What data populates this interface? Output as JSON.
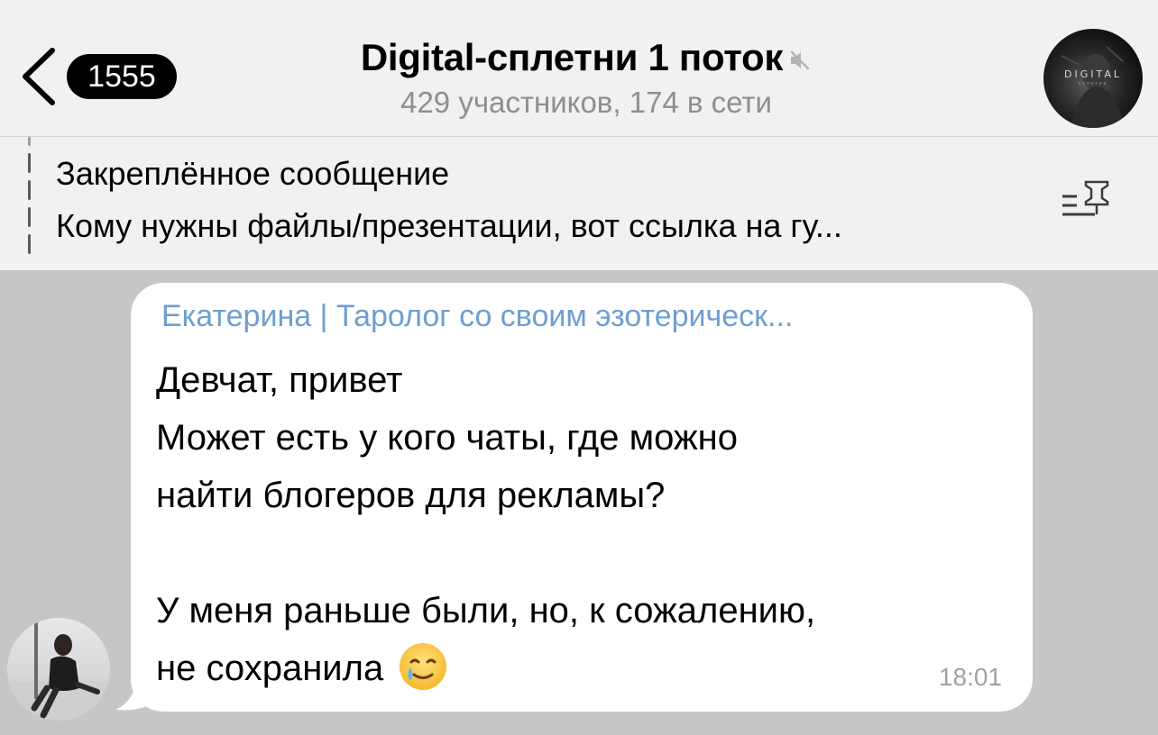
{
  "header": {
    "back_label": "back",
    "unread_count": "1555",
    "title": "Digital-сплетни 1 поток",
    "subtitle": "429 участников, 174 в сети",
    "avatar_logo": "DIGITAL",
    "avatar_logo_sub": "сплетни"
  },
  "pinned": {
    "title": "Закреплённое сообщение",
    "text": "Кому нужны файлы/презентации, вот ссылка на гу..."
  },
  "message": {
    "sender": "Екатерина | Таролог со своим эзотерическ...",
    "lines": [
      "Девчат, привет",
      "Может есть у кого чаты, где можно",
      "найти блогеров для рекламы?",
      "",
      "У меня раньше были, но, к сожалению,",
      "не сохранила"
    ],
    "emoji": "smiling-face-with-tear",
    "time": "18:01"
  },
  "colors": {
    "header_bg": "#f1f1f2",
    "chat_bg": "#c6c6c8",
    "sender_color": "#6f9ed0"
  }
}
